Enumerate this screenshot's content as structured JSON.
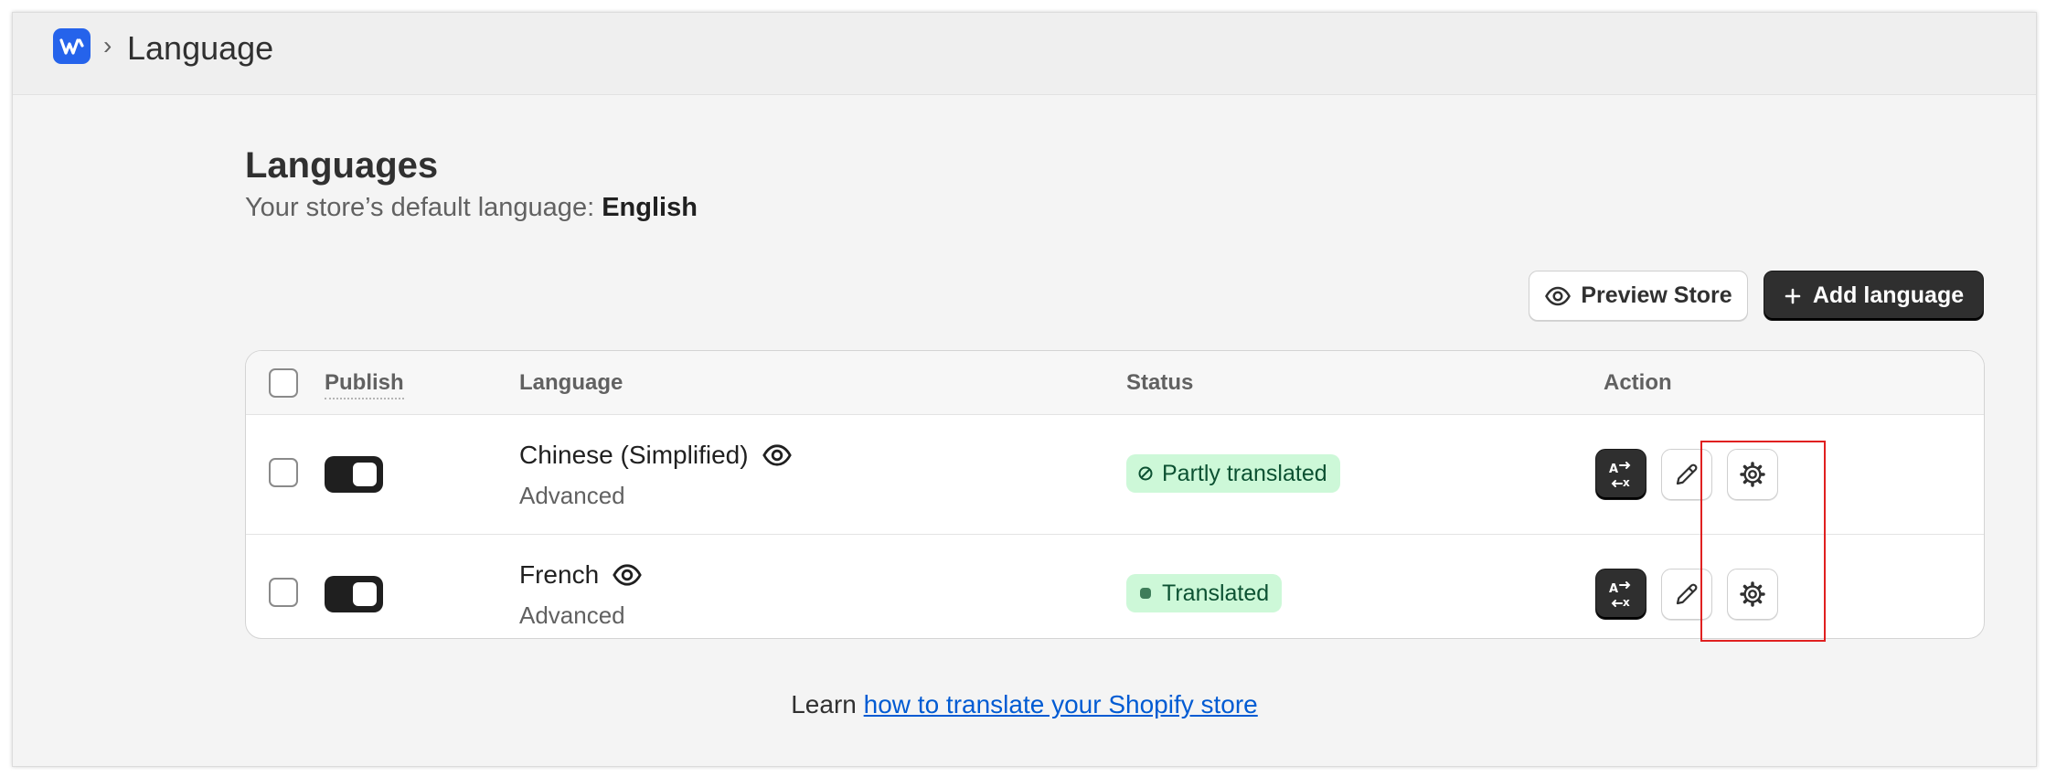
{
  "header": {
    "separator": "›",
    "title": "Language"
  },
  "page": {
    "title": "Languages",
    "default_language_prefix": "Your store’s default language:",
    "default_language": "English"
  },
  "toolbar": {
    "preview_label": "Preview Store",
    "add_label": "Add language"
  },
  "table": {
    "headers": {
      "publish": "Publish",
      "language": "Language",
      "status": "Status",
      "action": "Action"
    },
    "rows": [
      {
        "name": "Chinese (Simplified)",
        "plan": "Advanced",
        "status": "Partly translated",
        "status_icon": "partial-circle-icon",
        "published": true
      },
      {
        "name": "French",
        "plan": "Advanced",
        "status": "Translated",
        "status_icon": "dot-icon",
        "published": true
      }
    ]
  },
  "footer": {
    "prefix": "Learn",
    "link_text": "how to translate your Shopify store"
  },
  "colors": {
    "brand": "#2563eb",
    "badge_bg": "#cdf8d8",
    "badge_text": "#0c5132",
    "link": "#005bd3",
    "highlight": "#e02020"
  }
}
